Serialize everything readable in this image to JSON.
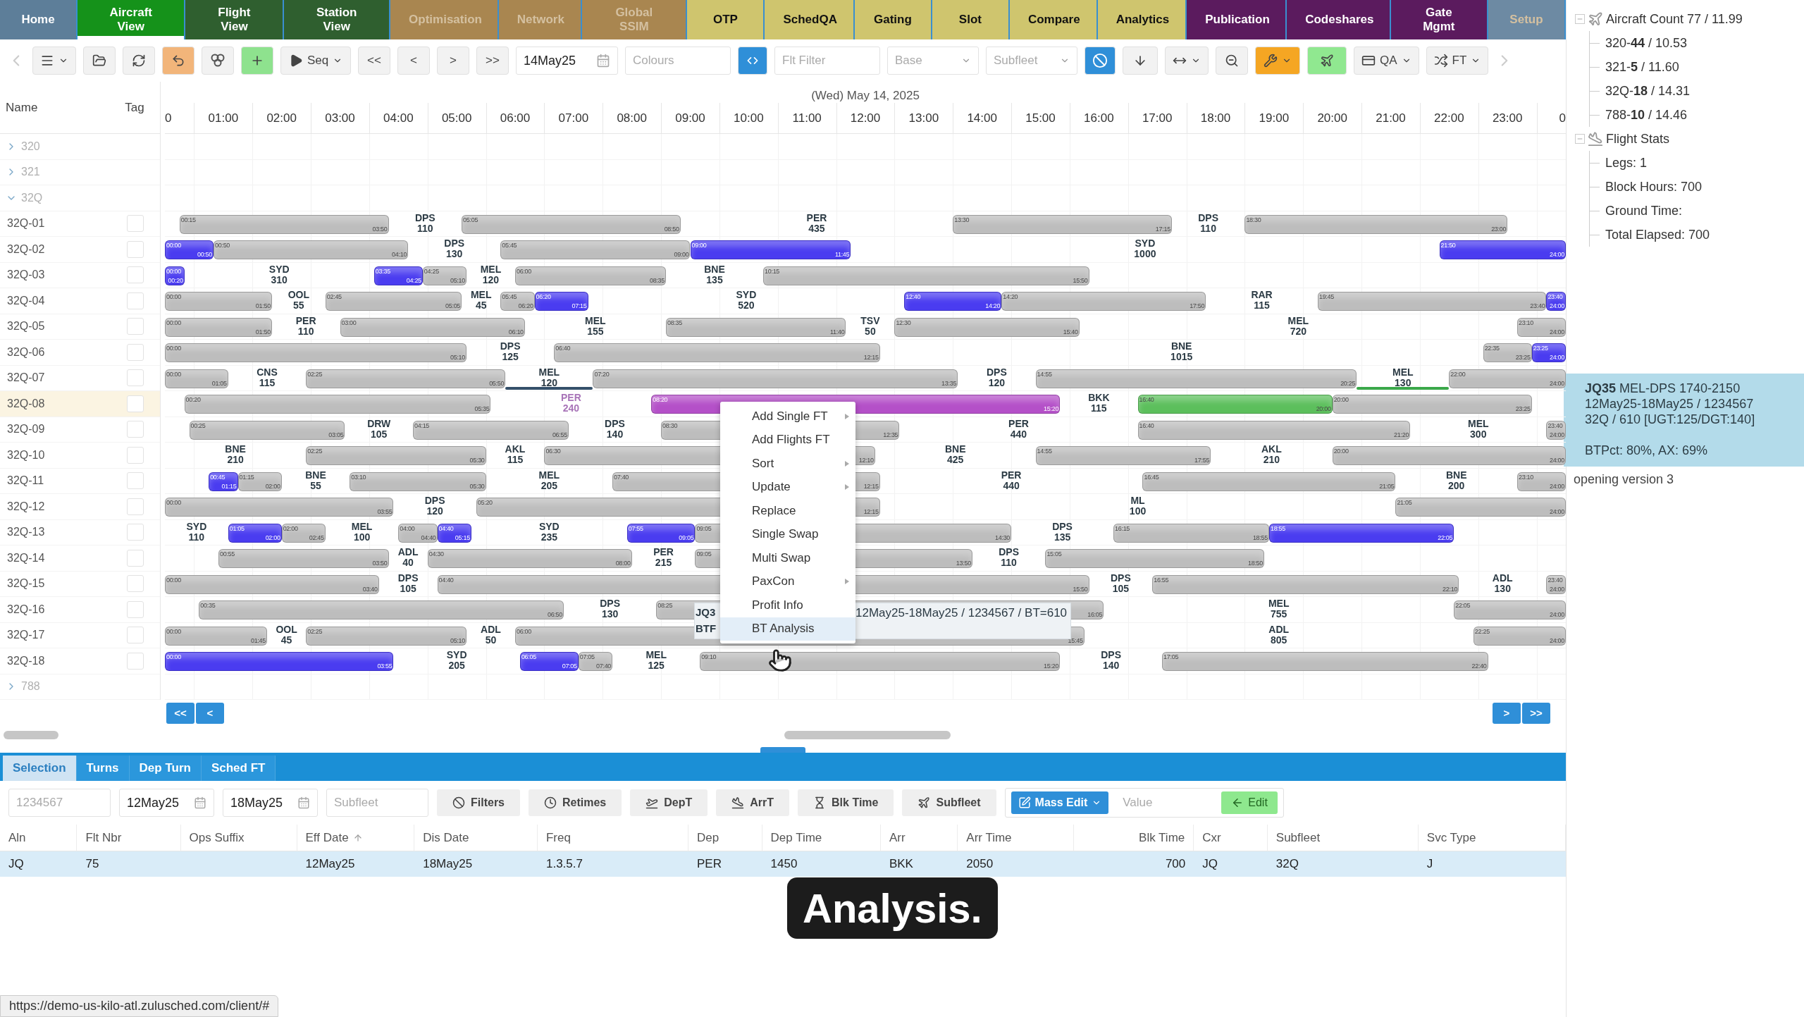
{
  "nav": [
    {
      "label": "Home",
      "color": "#5d7e99",
      "selected": false,
      "disabled": false
    },
    {
      "label": "Aircraft View",
      "color": "#15921a",
      "selected": true,
      "disabled": false
    },
    {
      "label": "Flight View",
      "color": "#2f5f2f",
      "selected": false,
      "disabled": false
    },
    {
      "label": "Station View",
      "color": "#2f5f2f",
      "selected": false,
      "disabled": false
    },
    {
      "label": "Optimisation",
      "color": "#a98650",
      "selected": false,
      "disabled": true
    },
    {
      "label": "Network",
      "color": "#a98650",
      "selected": false,
      "disabled": true
    },
    {
      "label": "Global SSIM",
      "color": "#a98650",
      "selected": false,
      "disabled": true
    },
    {
      "label": "OTP",
      "color": "#cfc56e",
      "selected": false,
      "disabled": false
    },
    {
      "label": "SchedQA",
      "color": "#cfc56e",
      "selected": false,
      "disabled": false
    },
    {
      "label": "Gating",
      "color": "#cfc56e",
      "selected": false,
      "disabled": false
    },
    {
      "label": "Slot",
      "color": "#cfc56e",
      "selected": false,
      "disabled": false
    },
    {
      "label": "Compare",
      "color": "#cfc56e",
      "selected": false,
      "disabled": false
    },
    {
      "label": "Analytics",
      "color": "#cfc56e",
      "selected": false,
      "disabled": false
    },
    {
      "label": "Publication",
      "color": "#5b1b5e",
      "selected": false,
      "disabled": false
    },
    {
      "label": "Codeshares",
      "color": "#5b1b5e",
      "selected": false,
      "disabled": false
    },
    {
      "label": "Gate Mgmt",
      "color": "#5b1b5e",
      "selected": false,
      "disabled": false
    },
    {
      "label": "Setup",
      "color": "#6d8aa3",
      "selected": false,
      "disabled": true
    }
  ],
  "toolbar": [
    {
      "kind": "back"
    },
    {
      "kind": "menu"
    },
    {
      "kind": "open"
    },
    {
      "kind": "refresh"
    },
    {
      "kind": "undo"
    },
    {
      "kind": "link"
    },
    {
      "kind": "add"
    },
    {
      "kind": "seq",
      "label": "Seq"
    },
    {
      "kind": "nav",
      "label": "<<"
    },
    {
      "kind": "nav",
      "label": "<"
    },
    {
      "kind": "nav",
      "label": ">"
    },
    {
      "kind": "nav",
      "label": ">>"
    },
    {
      "kind": "date",
      "value": "14May25"
    },
    {
      "kind": "input",
      "placeholder": "Colours"
    },
    {
      "kind": "toggle"
    },
    {
      "kind": "input",
      "placeholder": "Flt Filter"
    },
    {
      "kind": "select",
      "placeholder": "Base"
    },
    {
      "kind": "select",
      "placeholder": "Subfleet"
    },
    {
      "kind": "block"
    },
    {
      "kind": "down"
    },
    {
      "kind": "width"
    },
    {
      "kind": "zoom"
    },
    {
      "kind": "tools"
    },
    {
      "kind": "plane"
    },
    {
      "kind": "qa",
      "label": "QA"
    },
    {
      "kind": "ft",
      "label": "FT"
    },
    {
      "kind": "more"
    }
  ],
  "columns": {
    "name": "Name",
    "tag": "Tag"
  },
  "date": "(Wed) May 14, 2025",
  "hours": [
    "0",
    "01:00",
    "02:00",
    "03:00",
    "04:00",
    "05:00",
    "06:00",
    "07:00",
    "08:00",
    "09:00",
    "10:00",
    "11:00",
    "12:00",
    "13:00",
    "14:00",
    "15:00",
    "16:00",
    "17:00",
    "18:00",
    "19:00",
    "20:00",
    "21:00",
    "22:00",
    "23:00",
    "0"
  ],
  "aircraft": [
    {
      "name": "320",
      "expanded": false
    },
    {
      "name": "321",
      "expanded": false
    },
    {
      "name": "32Q",
      "expanded": true,
      "children": [
        {
          "name": "32Q-01",
          "selected": false,
          "items": [
            {
              "kind": "bar",
              "start": "00:15",
              "end": "03:50",
              "color": "#bdbdbd"
            },
            {
              "kind": "gap",
              "station": "DPS",
              "mins": "110"
            },
            {
              "kind": "bar",
              "start": "05:05",
              "end": "08:50",
              "color": "#bdbdbd"
            },
            {
              "kind": "gap",
              "station": "PER",
              "mins": "435"
            },
            {
              "kind": "bar",
              "start": "13:30",
              "end": "17:15",
              "color": "#bdbdbd"
            },
            {
              "kind": "gap",
              "station": "DPS",
              "mins": "110"
            },
            {
              "kind": "bar",
              "start": "18:30",
              "end": "23:00",
              "color": "#bdbdbd"
            }
          ]
        },
        {
          "name": "32Q-02",
          "selected": false,
          "items": [
            {
              "kind": "bar",
              "start": "00:00",
              "end": "00:50",
              "color": "#4a3cf0"
            },
            {
              "kind": "bar",
              "start": "00:50",
              "end": "04:10",
              "color": "#bdbdbd"
            },
            {
              "kind": "gap",
              "station": "DPS",
              "mins": "130"
            },
            {
              "kind": "bar",
              "start": "05:45",
              "end": "09:00",
              "color": "#bdbdbd"
            },
            {
              "kind": "bar",
              "start": "09:00",
              "end": "11:45",
              "color": "#4a3cf0"
            },
            {
              "kind": "gap",
              "station": "SYD",
              "mins": "1000"
            },
            {
              "kind": "bar",
              "start": "21:50",
              "end": "24:00",
              "color": "#4a3cf0"
            }
          ]
        },
        {
          "name": "32Q-03",
          "selected": false,
          "items": [
            {
              "kind": "bar",
              "start": "00:00",
              "end": "00:20",
              "color": "#4a3cf0"
            },
            {
              "kind": "gap",
              "station": "SYD",
              "mins": "310"
            },
            {
              "kind": "bar",
              "start": "03:35",
              "end": "04:25",
              "color": "#4a3cf0"
            },
            {
              "kind": "bar",
              "start": "04:25",
              "end": "05:10",
              "color": "#bdbdbd"
            },
            {
              "kind": "gap",
              "station": "MEL",
              "mins": "120"
            },
            {
              "kind": "bar",
              "start": "06:00",
              "end": "08:35",
              "color": "#bdbdbd"
            },
            {
              "kind": "gap",
              "station": "BNE",
              "mins": "135"
            },
            {
              "kind": "bar",
              "start": "10:15",
              "end": "15:50",
              "color": "#bdbdbd"
            }
          ]
        },
        {
          "name": "32Q-04",
          "selected": false,
          "items": [
            {
              "kind": "bar",
              "start": "00:00",
              "end": "01:50",
              "color": "#bdbdbd"
            },
            {
              "kind": "gap",
              "station": "OOL",
              "mins": "55"
            },
            {
              "kind": "bar",
              "start": "02:45",
              "end": "05:05",
              "color": "#bdbdbd"
            },
            {
              "kind": "gap",
              "station": "MEL",
              "mins": "45"
            },
            {
              "kind": "bar",
              "start": "05:45",
              "end": "06:20",
              "color": "#bdbdbd"
            },
            {
              "kind": "bar",
              "start": "06:20",
              "end": "07:15",
              "color": "#4a3cf0"
            },
            {
              "kind": "gap",
              "station": "SYD",
              "mins": "520"
            },
            {
              "kind": "bar",
              "start": "12:40",
              "end": "14:20",
              "color": "#4a3cf0"
            },
            {
              "kind": "bar",
              "start": "14:20",
              "end": "17:50",
              "color": "#bdbdbd"
            },
            {
              "kind": "gap",
              "station": "RAR",
              "mins": "115"
            },
            {
              "kind": "bar",
              "start": "19:45",
              "end": "23:40",
              "color": "#bdbdbd"
            },
            {
              "kind": "bar",
              "start": "23:40",
              "end": "24:00",
              "color": "#4a3cf0"
            }
          ]
        },
        {
          "name": "32Q-05",
          "selected": false,
          "items": [
            {
              "kind": "bar",
              "start": "00:00",
              "end": "01:50",
              "color": "#bdbdbd"
            },
            {
              "kind": "gap",
              "station": "PER",
              "mins": "110"
            },
            {
              "kind": "bar",
              "start": "03:00",
              "end": "06:10",
              "color": "#bdbdbd"
            },
            {
              "kind": "gap",
              "station": "MEL",
              "mins": "155"
            },
            {
              "kind": "bar",
              "start": "08:35",
              "end": "11:40",
              "color": "#bdbdbd"
            },
            {
              "kind": "gap",
              "station": "TSV",
              "mins": "50"
            },
            {
              "kind": "bar",
              "start": "12:30",
              "end": "15:40",
              "color": "#bdbdbd"
            },
            {
              "kind": "gap",
              "station": "MEL",
              "mins": "720"
            },
            {
              "kind": "bar",
              "start": "23:10",
              "end": "24:00",
              "color": "#bdbdbd"
            }
          ]
        },
        {
          "name": "32Q-06",
          "selected": false,
          "items": [
            {
              "kind": "bar",
              "start": "00:00",
              "end": "05:10",
              "color": "#bdbdbd"
            },
            {
              "kind": "gap",
              "station": "DPS",
              "mins": "125"
            },
            {
              "kind": "bar",
              "start": "06:40",
              "end": "12:15",
              "color": "#bdbdbd"
            },
            {
              "kind": "gap",
              "station": "BNE",
              "mins": "1015"
            },
            {
              "kind": "bar",
              "start": "22:35",
              "end": "23:25",
              "color": "#bdbdbd"
            },
            {
              "kind": "bar",
              "start": "23:25",
              "end": "24:00",
              "color": "#4a3cf0"
            }
          ]
        },
        {
          "name": "32Q-07",
          "selected": false,
          "items": [
            {
              "kind": "bar",
              "start": "00:00",
              "end": "01:05",
              "color": "#bdbdbd"
            },
            {
              "kind": "gap",
              "station": "CNS",
              "mins": "115"
            },
            {
              "kind": "bar",
              "start": "02:25",
              "end": "05:50",
              "color": "#bdbdbd"
            },
            {
              "kind": "gap",
              "station": "MEL",
              "mins": "120",
              "underline": {
                "color": "#34506a"
              }
            },
            {
              "kind": "bar",
              "start": "07:20",
              "end": "13:35",
              "color": "#bdbdbd"
            },
            {
              "kind": "gap",
              "station": "DPS",
              "mins": "120"
            },
            {
              "kind": "bar",
              "start": "14:55",
              "end": "20:25",
              "color": "#bdbdbd"
            },
            {
              "kind": "gap",
              "station": "MEL",
              "mins": "130",
              "underline": {
                "color": "#3aa84a"
              }
            },
            {
              "kind": "bar",
              "start": "22:00",
              "end": "24:00",
              "color": "#bdbdbd"
            }
          ]
        },
        {
          "name": "32Q-08",
          "selected": true,
          "items": [
            {
              "kind": "bar",
              "start": "00:20",
              "end": "05:35",
              "color": "#bdbdbd"
            },
            {
              "kind": "gap",
              "station": "PER",
              "mins": "240",
              "color": "#a874b8"
            },
            {
              "kind": "bar",
              "start": "08:20",
              "end": "15:20",
              "color": "#b450c8"
            },
            {
              "kind": "gap",
              "station": "BKK",
              "mins": "115"
            },
            {
              "kind": "bar",
              "start": "16:40",
              "end": "20:00",
              "color": "#5cbf5c"
            },
            {
              "kind": "bar",
              "start": "20:00",
              "end": "23:25",
              "color": "#bdbdbd"
            }
          ]
        },
        {
          "name": "32Q-09",
          "selected": false,
          "items": [
            {
              "kind": "bar",
              "start": "00:25",
              "end": "03:05",
              "color": "#bdbdbd"
            },
            {
              "kind": "gap",
              "station": "DRW",
              "mins": "105"
            },
            {
              "kind": "bar",
              "start": "04:15",
              "end": "06:55",
              "color": "#bdbdbd"
            },
            {
              "kind": "gap",
              "station": "DPS",
              "mins": "140"
            },
            {
              "kind": "bar",
              "start": "08:30",
              "end": "12:35",
              "color": "#bdbdbd"
            },
            {
              "kind": "gap",
              "station": "PER",
              "mins": "440"
            },
            {
              "kind": "bar",
              "start": "16:40",
              "end": "21:20",
              "color": "#bdbdbd"
            },
            {
              "kind": "gap",
              "station": "MEL",
              "mins": "300"
            },
            {
              "kind": "bar",
              "start": "23:40",
              "end": "24:00",
              "color": "#bdbdbd"
            }
          ]
        },
        {
          "name": "32Q-10",
          "selected": false,
          "items": [
            {
              "kind": "gap",
              "station": "BNE",
              "mins": "210"
            },
            {
              "kind": "bar",
              "start": "02:25",
              "end": "05:30",
              "color": "#bdbdbd"
            },
            {
              "kind": "gap",
              "station": "AKL",
              "mins": "115"
            },
            {
              "kind": "bar",
              "start": "06:30",
              "end": "12:10",
              "color": "#bdbdbd"
            },
            {
              "kind": "gap",
              "station": "BNE",
              "mins": "425"
            },
            {
              "kind": "bar",
              "start": "14:55",
              "end": "17:55",
              "color": "#bdbdbd"
            },
            {
              "kind": "gap",
              "station": "AKL",
              "mins": "210"
            },
            {
              "kind": "bar",
              "start": "20:00",
              "end": "24:00",
              "color": "#bdbdbd"
            }
          ]
        },
        {
          "name": "32Q-11",
          "selected": false,
          "items": [
            {
              "kind": "bar",
              "start": "00:45",
              "end": "01:15",
              "color": "#4a3cf0"
            },
            {
              "kind": "bar",
              "start": "01:15",
              "end": "02:00",
              "color": "#bdbdbd"
            },
            {
              "kind": "gap",
              "station": "BNE",
              "mins": "55"
            },
            {
              "kind": "bar",
              "start": "03:10",
              "end": "05:30",
              "color": "#bdbdbd"
            },
            {
              "kind": "gap",
              "station": "MEL",
              "mins": "205"
            },
            {
              "kind": "bar",
              "start": "07:40",
              "end": "12:15",
              "color": "#bdbdbd"
            },
            {
              "kind": "gap",
              "station": "PER",
              "mins": "440"
            },
            {
              "kind": "bar",
              "start": "16:45",
              "end": "21:05",
              "color": "#bdbdbd"
            },
            {
              "kind": "gap",
              "station": "BNE",
              "mins": "200"
            },
            {
              "kind": "bar",
              "start": "23:10",
              "end": "24:00",
              "color": "#bdbdbd"
            }
          ]
        },
        {
          "name": "32Q-12",
          "selected": false,
          "items": [
            {
              "kind": "bar",
              "start": "00:00",
              "end": "03:55",
              "color": "#bdbdbd"
            },
            {
              "kind": "gap",
              "station": "DPS",
              "mins": "120"
            },
            {
              "kind": "bar",
              "start": "05:20",
              "end": "12:15",
              "color": "#bdbdbd"
            },
            {
              "kind": "gap",
              "station": "ML",
              "mins": "100"
            },
            {
              "kind": "bar",
              "start": "21:05",
              "end": "24:00",
              "color": "#bdbdbd"
            }
          ]
        },
        {
          "name": "32Q-13",
          "selected": false,
          "items": [
            {
              "kind": "gap",
              "station": "SYD",
              "mins": "110"
            },
            {
              "kind": "bar",
              "start": "01:05",
              "end": "02:00",
              "color": "#4a3cf0"
            },
            {
              "kind": "bar",
              "start": "02:00",
              "end": "02:45",
              "color": "#bdbdbd"
            },
            {
              "kind": "gap",
              "station": "MEL",
              "mins": "100"
            },
            {
              "kind": "bar",
              "start": "04:00",
              "end": "04:40",
              "color": "#bdbdbd"
            },
            {
              "kind": "bar",
              "start": "04:40",
              "end": "05:15",
              "color": "#4a3cf0"
            },
            {
              "kind": "gap",
              "station": "SYD",
              "mins": "235"
            },
            {
              "kind": "bar",
              "start": "07:55",
              "end": "09:05",
              "color": "#4a3cf0"
            },
            {
              "kind": "bar",
              "start": "09:05",
              "end": "14:30",
              "color": "#bdbdbd"
            },
            {
              "kind": "gap",
              "station": "DPS",
              "mins": "135"
            },
            {
              "kind": "bar",
              "start": "16:15",
              "end": "18:55",
              "color": "#bdbdbd"
            },
            {
              "kind": "bar",
              "start": "18:55",
              "end": "22:05",
              "color": "#4a3cf0"
            }
          ]
        },
        {
          "name": "32Q-14",
          "selected": false,
          "items": [
            {
              "kind": "bar",
              "start": "00:55",
              "end": "03:50",
              "color": "#bdbdbd"
            },
            {
              "kind": "gap",
              "station": "ADL",
              "mins": "40"
            },
            {
              "kind": "bar",
              "start": "04:30",
              "end": "08:00",
              "color": "#bdbdbd"
            },
            {
              "kind": "gap",
              "station": "PER",
              "mins": "215"
            },
            {
              "kind": "bar",
              "start": "09:05",
              "end": "13:50",
              "color": "#bdbdbd"
            },
            {
              "kind": "gap",
              "station": "DPS",
              "mins": "110"
            },
            {
              "kind": "bar",
              "start": "15:05",
              "end": "18:50",
              "color": "#bdbdbd"
            }
          ]
        },
        {
          "name": "32Q-15",
          "selected": false,
          "items": [
            {
              "kind": "bar",
              "start": "00:00",
              "end": "03:40",
              "color": "#bdbdbd"
            },
            {
              "kind": "gap",
              "station": "DPS",
              "mins": "105"
            },
            {
              "kind": "bar",
              "start": "04:40",
              "end": "15:50",
              "color": "#bdbdbd"
            },
            {
              "kind": "gap",
              "station": "DPS",
              "mins": "105"
            },
            {
              "kind": "bar",
              "start": "16:55",
              "end": "22:10",
              "color": "#bdbdbd"
            },
            {
              "kind": "gap",
              "station": "ADL",
              "mins": "130"
            },
            {
              "kind": "bar",
              "start": "23:40",
              "end": "24:00",
              "color": "#bdbdbd"
            }
          ]
        },
        {
          "name": "32Q-16",
          "selected": false,
          "items": [
            {
              "kind": "bar",
              "start": "00:35",
              "end": "06:50",
              "color": "#bdbdbd"
            },
            {
              "kind": "gap",
              "station": "DPS",
              "mins": "130"
            },
            {
              "kind": "bar",
              "start": "08:25",
              "end": "16:05",
              "color": "#bdbdbd"
            },
            {
              "kind": "gap",
              "station": "MEL",
              "mins": "755"
            },
            {
              "kind": "bar",
              "start": "22:05",
              "end": "24:00",
              "color": "#bdbdbd"
            }
          ]
        },
        {
          "name": "32Q-17",
          "selected": false,
          "items": [
            {
              "kind": "bar",
              "start": "00:00",
              "end": "01:45",
              "color": "#bdbdbd"
            },
            {
              "kind": "gap",
              "station": "OOL",
              "mins": "45"
            },
            {
              "kind": "bar",
              "start": "02:25",
              "end": "05:10",
              "color": "#bdbdbd"
            },
            {
              "kind": "gap",
              "station": "ADL",
              "mins": "50"
            },
            {
              "kind": "bar",
              "start": "06:00",
              "end": "15:45",
              "color": "#bdbdbd"
            },
            {
              "kind": "gap",
              "station": "ADL",
              "mins": "805"
            },
            {
              "kind": "bar",
              "start": "22:25",
              "end": "24:00",
              "color": "#bdbdbd"
            }
          ]
        },
        {
          "name": "32Q-18",
          "selected": false,
          "items": [
            {
              "kind": "bar",
              "start": "00:00",
              "end": "03:55",
              "color": "#4a3cf0"
            },
            {
              "kind": "gap",
              "station": "SYD",
              "mins": "205"
            },
            {
              "kind": "bar",
              "start": "06:05",
              "end": "07:05",
              "color": "#4a3cf0"
            },
            {
              "kind": "bar",
              "start": "07:05",
              "end": "07:40",
              "color": "#bdbdbd"
            },
            {
              "kind": "gap",
              "station": "MEL",
              "mins": "125"
            },
            {
              "kind": "bar",
              "start": "09:10",
              "end": "15:20",
              "color": "#bdbdbd"
            },
            {
              "kind": "gap",
              "station": "DPS",
              "mins": "140"
            },
            {
              "kind": "bar",
              "start": "17:05",
              "end": "22:40",
              "color": "#bdbdbd"
            }
          ]
        }
      ]
    },
    {
      "name": "788",
      "expanded": false
    }
  ],
  "context_menu": [
    {
      "label": "Add Single FT",
      "submenu": true,
      "selected": false
    },
    {
      "label": "Add Flights FT",
      "submenu": false,
      "selected": false
    },
    {
      "label": "Sort",
      "submenu": true,
      "selected": false
    },
    {
      "label": "Update",
      "submenu": true,
      "selected": false
    },
    {
      "label": "Replace",
      "submenu": false,
      "selected": false
    },
    {
      "label": "Single Swap",
      "submenu": false,
      "selected": false
    },
    {
      "label": "Multi Swap",
      "submenu": false,
      "selected": false
    },
    {
      "label": "PaxCon",
      "submenu": true,
      "selected": false
    },
    {
      "label": "Profit Info",
      "submenu": false,
      "selected": false
    },
    {
      "label": "BT Analysis",
      "submenu": false,
      "selected": true
    }
  ],
  "flight_tooltip": {
    "line_1": "JQ3",
    "line_2": "BTF",
    "detail": "12May25-18May25 / 1234567 / BT=610"
  },
  "chart_nav": {
    "left": [
      "<<",
      "<"
    ],
    "right": [
      ">",
      ">>"
    ]
  },
  "side_tree": [
    {
      "label": "Aircraft Count 77 / 11.99",
      "kind": "aircraft",
      "expanded": true,
      "children": [
        {
          "label": "320-**44** / 10.53"
        },
        {
          "label": "321-**5** / 11.60"
        },
        {
          "label": "32Q-**18** / 14.31"
        },
        {
          "label": "788-**10** / 14.46"
        }
      ]
    },
    {
      "label": "Flight Stats",
      "kind": "flights",
      "expanded": true,
      "children": [
        {
          "label": "Legs: 1"
        },
        {
          "label": "Block Hours: 700"
        },
        {
          "label": "Ground Time:"
        },
        {
          "label": "Total Elapsed: 700"
        }
      ]
    }
  ],
  "selection_info": {
    "lines": [
      "**JQ35** MEL-DPS 1740-2150",
      "12May25-18May25 / 1234567",
      "32Q / 610 [UGT:125/DGT:140]"
    ],
    "footer": "BTPct: 80%, AX: 69%"
  },
  "status_message": "opening version 3",
  "bottom_tabs": [
    {
      "label": "Selection",
      "selected": true
    },
    {
      "label": "Turns",
      "selected": false
    },
    {
      "label": "Dep Turn",
      "selected": false
    },
    {
      "label": "Sched FT",
      "selected": false
    }
  ],
  "filters": [
    {
      "kind": "input",
      "placeholder": "1234567"
    },
    {
      "kind": "date",
      "value": "12May25"
    },
    {
      "kind": "date",
      "value": "18May25"
    },
    {
      "kind": "input",
      "placeholder": "Subfleet"
    },
    {
      "kind": "filters",
      "label": "Filters"
    },
    {
      "kind": "retimes",
      "label": "Retimes"
    },
    {
      "kind": "dept",
      "label": "DepT"
    },
    {
      "kind": "arrt",
      "label": "ArrT"
    },
    {
      "kind": "blktime",
      "label": "Blk Time"
    },
    {
      "kind": "subfleet",
      "label": "Subfleet"
    }
  ],
  "mass_edit": {
    "label": "Mass Edit",
    "placeholder": "Value",
    "apply": "Edit"
  },
  "table": {
    "columns": [
      {
        "label": "Aln",
        "sorted": false
      },
      {
        "label": "Flt Nbr",
        "sorted": false
      },
      {
        "label": "Ops Suffix",
        "sorted": false
      },
      {
        "label": "Eff Date",
        "sorted": true
      },
      {
        "label": "Dis Date",
        "sorted": false
      },
      {
        "label": "Freq",
        "sorted": false
      },
      {
        "label": "Dep",
        "sorted": false
      },
      {
        "label": "Dep Time",
        "sorted": false
      },
      {
        "label": "Arr",
        "sorted": false
      },
      {
        "label": "Arr Time",
        "sorted": false
      },
      {
        "label": "Blk Time",
        "sorted": false,
        "numeric": true
      },
      {
        "label": "Cxr",
        "sorted": false
      },
      {
        "label": "Subfleet",
        "sorted": false
      },
      {
        "label": "Svc Type",
        "sorted": false
      }
    ],
    "rows": [
      {
        "selected": true,
        "cells": [
          "JQ",
          "75",
          null,
          "12May25",
          "18May25",
          "1.3.5.7",
          "PER",
          "1450",
          "BKK",
          "2050",
          "700",
          "JQ",
          "32Q",
          "J"
        ]
      }
    ]
  },
  "caption": "Analysis.",
  "status_url": "https://demo-us-kilo-atl.zulusched.com/client/#"
}
